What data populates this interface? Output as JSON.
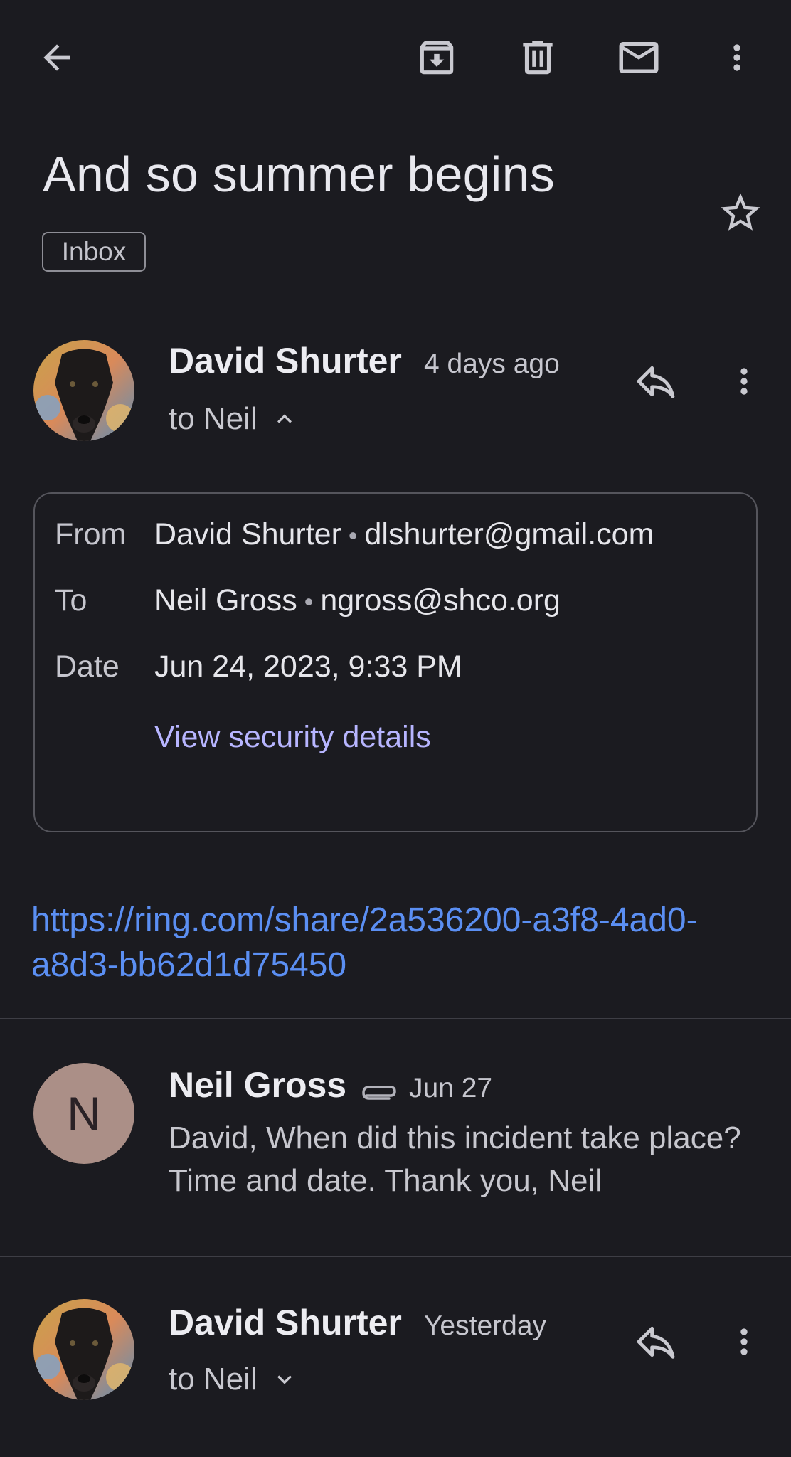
{
  "toolbar": {
    "back_icon": "arrow-back-icon",
    "archive_icon": "archive-icon",
    "delete_icon": "trash-icon",
    "mark_unread_icon": "mail-icon",
    "more_icon": "more-vert-icon"
  },
  "subject": "And so summer begins",
  "label_chip": "Inbox",
  "messages": [
    {
      "sender": "David Shurter",
      "time": "4 days ago",
      "to": "to Neil",
      "expanded": true
    },
    {
      "sender": "Neil Gross",
      "time": "Jun 27",
      "avatar_letter": "N",
      "has_attachment": true,
      "snippet": "David, When did this incident take place? Time and date. Thank you, Neil"
    },
    {
      "sender": "David Shurter",
      "time": "Yesterday",
      "to": "to Neil",
      "expanded": false
    }
  ],
  "details": {
    "from_label": "From",
    "from_name": "David Shurter",
    "from_email": "dlshurter@gmail.com",
    "to_label": "To",
    "to_name": "Neil Gross",
    "to_email": "ngross@shco.org",
    "date_label": "Date",
    "date_value": "Jun 24, 2023, 9:33 PM",
    "security_link": "View security details"
  },
  "separator_dot": "•",
  "body_link": "https://ring.com/share/2a536200-a3f8-4ad0-a8d3-bb62d1d75450",
  "colors": {
    "background": "#1b1b20",
    "link": "#5b8ff3",
    "security_link": "#b7b5ff",
    "avatar_n_bg": "#ab8f87"
  }
}
